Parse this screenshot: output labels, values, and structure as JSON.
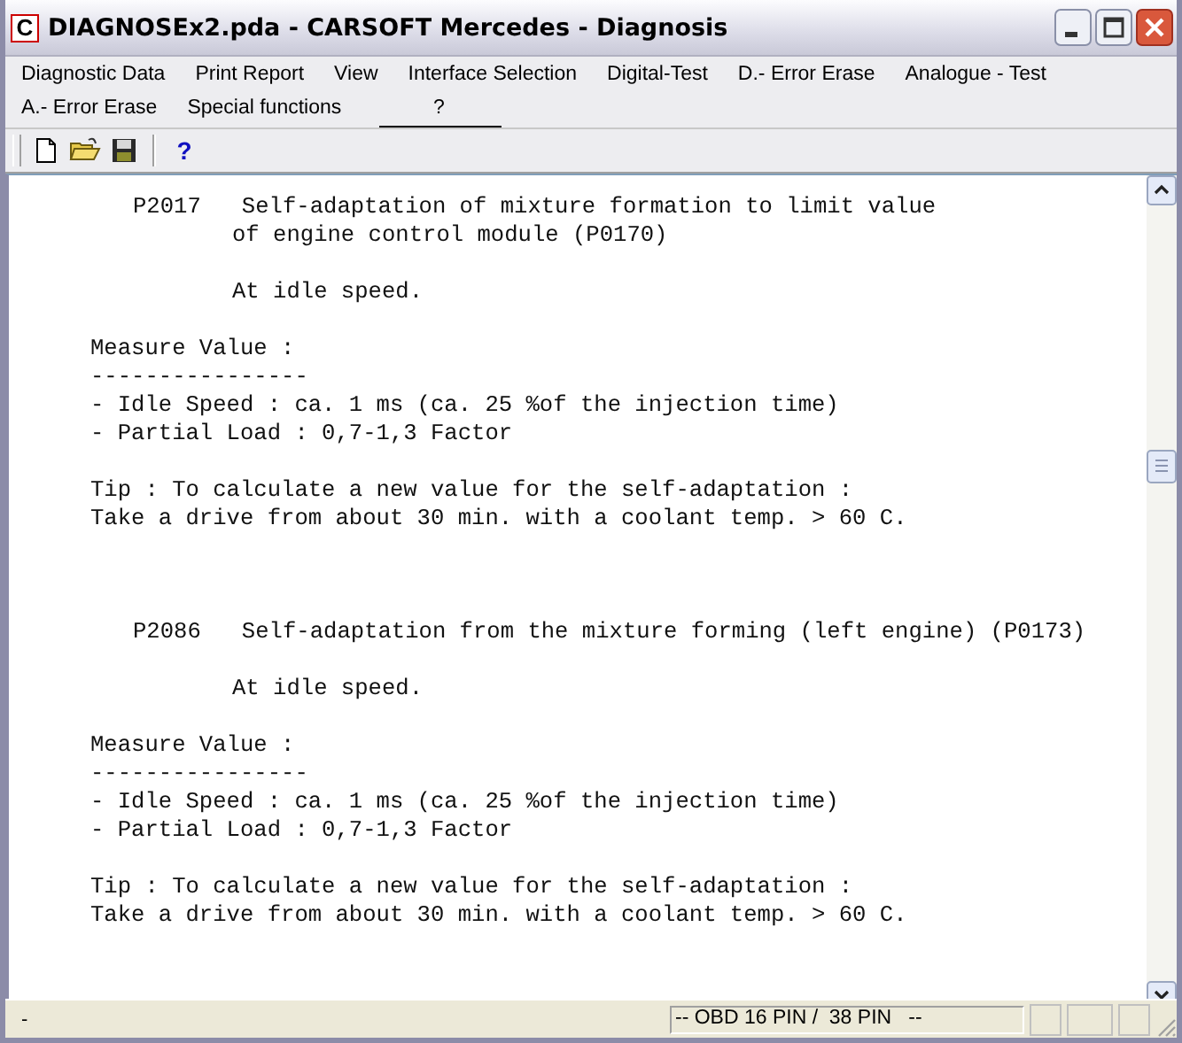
{
  "window": {
    "title": "DIAGNOSEx2.pda - CARSOFT Mercedes - Diagnosis",
    "app_icon": "C"
  },
  "menu": [
    {
      "label": "Diagnostic Data"
    },
    {
      "label": "Print Report"
    },
    {
      "label": "View"
    },
    {
      "label": "Interface Selection"
    },
    {
      "label": "Digital-Test"
    },
    {
      "label": "D.- Error Erase"
    },
    {
      "label": "Analogue - Test"
    },
    {
      "label": "A.- Error Erase"
    },
    {
      "label": "Special functions"
    },
    {
      "label": "?"
    }
  ],
  "toolbar": [
    {
      "kind": "new"
    },
    {
      "kind": "open"
    },
    {
      "kind": "save"
    },
    {
      "kind": "separator"
    },
    {
      "kind": "help",
      "label": "?"
    }
  ],
  "document": [
    {
      "paragraphs": [
        {
          "lines": [
            {
              "kind": "code",
              "text": "P2017   Self-adaptation of mixture formation to limit value"
            },
            {
              "kind": "note",
              "text": "of engine control module (P0170)"
            }
          ]
        },
        {
          "lines": [
            {
              "kind": "note",
              "text": "At idle speed."
            }
          ]
        },
        {
          "lines": [
            {
              "kind": "text",
              "text": "Measure Value :"
            },
            {
              "kind": "text",
              "text": "----------------"
            },
            {
              "kind": "text",
              "text": "- Idle Speed : ca. 1 ms (ca. 25 %of the injection time)"
            },
            {
              "kind": "text",
              "text": "- Partial Load : 0,7-1,3 Factor"
            }
          ]
        },
        {
          "lines": [
            {
              "kind": "text",
              "text": "Tip : To calculate a new value for the self-adaptation :"
            },
            {
              "kind": "text",
              "text": "Take a drive from about 30 min. with a coolant temp. > 60 C."
            }
          ]
        }
      ]
    },
    {
      "paragraphs": [
        {
          "lines": [
            {
              "kind": "code",
              "text": "P2086   Self-adaptation from the mixture forming (left engine) (P0173)"
            }
          ]
        },
        {
          "lines": [
            {
              "kind": "note",
              "text": "At idle speed."
            }
          ]
        },
        {
          "lines": [
            {
              "kind": "text",
              "text": "Measure Value :"
            },
            {
              "kind": "text",
              "text": "----------------"
            },
            {
              "kind": "text",
              "text": "- Idle Speed : ca. 1 ms (ca. 25 %of the injection time)"
            },
            {
              "kind": "text",
              "text": "- Partial Load : 0,7-1,3 Factor"
            }
          ]
        },
        {
          "lines": [
            {
              "kind": "text",
              "text": "Tip : To calculate a new value for the self-adaptation :"
            },
            {
              "kind": "text",
              "text": "Take a drive from about 30 min. with a coolant temp. > 60 C."
            }
          ]
        }
      ]
    }
  ],
  "status_bar": {
    "left": "-",
    "interface": "-- OBD 16 PIN /  38 PIN   --"
  }
}
